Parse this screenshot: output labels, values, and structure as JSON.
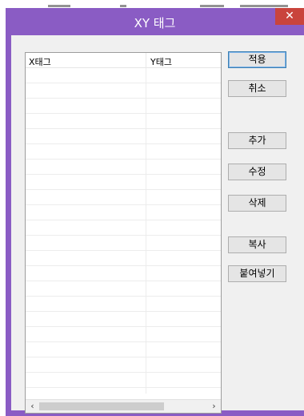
{
  "window": {
    "title": "XY 태그",
    "close_glyph": "✕"
  },
  "list": {
    "columns": [
      "X태그",
      "Y태그"
    ],
    "rows": [],
    "scroll_left_glyph": "‹",
    "scroll_right_glyph": "›"
  },
  "buttons": {
    "apply": "적용",
    "cancel": "취소",
    "add": "추가",
    "edit": "수정",
    "delete": "삭제",
    "copy": "복사",
    "paste": "붙여넣기"
  },
  "colors": {
    "title_bar": "#8a5cc4",
    "close_button": "#c9443c",
    "client_bg": "#f0f0f0"
  }
}
